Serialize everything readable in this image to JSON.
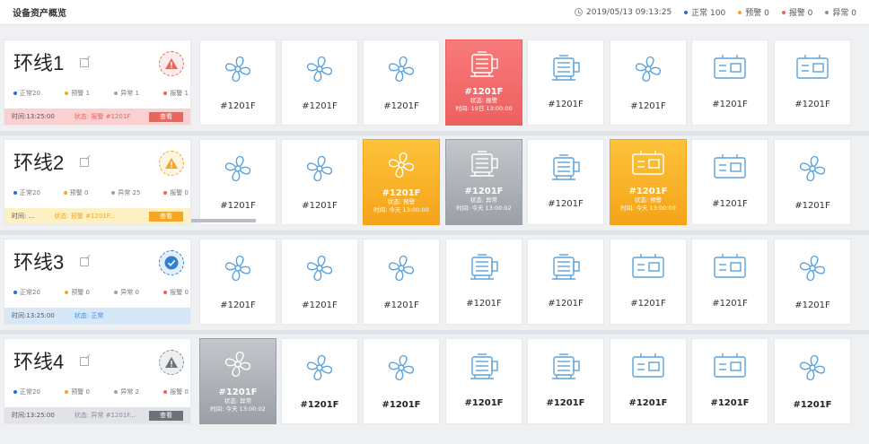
{
  "header": {
    "title": "设备资产概览",
    "datetime": "2019/05/13  09:13:25",
    "status_items": [
      {
        "label": "正常 100",
        "color": "#1f6fd1"
      },
      {
        "label": "预警 0",
        "color": "#f5a623"
      },
      {
        "label": "报警 0",
        "color": "#e8665c"
      },
      {
        "label": "异常 0",
        "color": "#8a8f96"
      }
    ]
  },
  "lines": [
    {
      "name": "环线1",
      "badge": "warning",
      "stats": [
        "正常20",
        "预警 1",
        "异常 1",
        "报警 1"
      ],
      "footer_time": "时间:13:25:00",
      "footer_status": "状态: 报警 #1201F",
      "button": "查看",
      "theme": "red",
      "tiles": [
        {
          "icon": "fan",
          "code": "#1201F"
        },
        {
          "icon": "fan",
          "code": "#1201F"
        },
        {
          "icon": "fan",
          "code": "#1201F"
        },
        {
          "icon": "motor",
          "code": "#1201F",
          "state": "red",
          "sub1": "状态: 报警",
          "sub2": "时间: 19日 13:00:00"
        },
        {
          "icon": "motor",
          "code": "#1201F"
        },
        {
          "icon": "fan",
          "code": "#1201F"
        },
        {
          "icon": "box",
          "code": "#1201F"
        },
        {
          "icon": "box",
          "code": "#1201F"
        }
      ]
    },
    {
      "name": "环线2",
      "badge": "caution",
      "stats": [
        "正常20",
        "预警 0",
        "异常 25",
        "报警 0"
      ],
      "footer_time": "时间: ...",
      "footer_status": "状态: 预警 #1201F...",
      "button": "查看",
      "theme": "yellow",
      "tiles": [
        {
          "icon": "fan",
          "code": "#1201F"
        },
        {
          "icon": "fan",
          "code": "#1201F"
        },
        {
          "icon": "fan",
          "code": "#1201F",
          "state": "yel",
          "sub1": "状态: 预警",
          "sub2": "时间: 今天 13:00:00"
        },
        {
          "icon": "motor",
          "code": "#1201F",
          "state": "gry",
          "sub1": "状态: 异常",
          "sub2": "时间: 今天 13:00:02"
        },
        {
          "icon": "motor",
          "code": "#1201F"
        },
        {
          "icon": "box",
          "code": "#1201F",
          "state": "yel",
          "sub1": "状态: 预警",
          "sub2": "时间: 今天 13:00:00"
        },
        {
          "icon": "box",
          "code": "#1201F"
        },
        {
          "icon": "fan",
          "code": "#1201F"
        }
      ]
    },
    {
      "name": "环线3",
      "badge": "ok",
      "stats": [
        "正常20",
        "预警 0",
        "异常 0",
        "报警 0"
      ],
      "footer_time": "时间:13:25:00",
      "footer_status": "状态: 正常",
      "button": "",
      "theme": "blue",
      "tiles": [
        {
          "icon": "fan",
          "code": "#1201F"
        },
        {
          "icon": "fan",
          "code": "#1201F"
        },
        {
          "icon": "fan",
          "code": "#1201F"
        },
        {
          "icon": "motor",
          "code": "#1201F"
        },
        {
          "icon": "motor",
          "code": "#1201F"
        },
        {
          "icon": "box",
          "code": "#1201F"
        },
        {
          "icon": "box",
          "code": "#1201F"
        },
        {
          "icon": "fan",
          "code": "#1201F"
        }
      ]
    },
    {
      "name": "环线4",
      "badge": "abnormal",
      "stats": [
        "正常20",
        "预警 0",
        "异常 2",
        "报警 0"
      ],
      "footer_time": "时间:13:25:00",
      "footer_status": "状态: 异常 #1201F...",
      "button": "查看",
      "theme": "grey",
      "tiles": [
        {
          "icon": "fan",
          "code": "#1201F",
          "state": "gry",
          "sub1": "状态: 异常",
          "sub2": "时间: 今天 13:00:02"
        },
        {
          "icon": "fan",
          "code": "#1201F"
        },
        {
          "icon": "fan",
          "code": "#1201F"
        },
        {
          "icon": "motor",
          "code": "#1201F"
        },
        {
          "icon": "motor",
          "code": "#1201F"
        },
        {
          "icon": "box",
          "code": "#1201F"
        },
        {
          "icon": "box",
          "code": "#1201F"
        },
        {
          "icon": "fan",
          "code": "#1201F"
        }
      ]
    }
  ]
}
